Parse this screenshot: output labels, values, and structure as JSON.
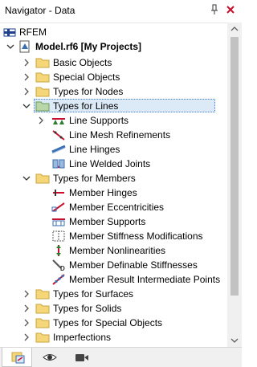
{
  "window": {
    "title": "Navigator - Data"
  },
  "tree": {
    "root": "RFEM",
    "model": "Model.rf6 [My Projects]",
    "items": [
      {
        "label": "Basic Objects"
      },
      {
        "label": "Special Objects"
      },
      {
        "label": "Types for Nodes"
      },
      {
        "label": "Types for Lines"
      },
      {
        "label": "Line Supports"
      },
      {
        "label": "Line Mesh Refinements"
      },
      {
        "label": "Line Hinges"
      },
      {
        "label": "Line Welded Joints"
      },
      {
        "label": "Types for Members"
      },
      {
        "label": "Member Hinges"
      },
      {
        "label": "Member Eccentricities"
      },
      {
        "label": "Member Supports"
      },
      {
        "label": "Member Stiffness Modifications"
      },
      {
        "label": "Member Nonlinearities"
      },
      {
        "label": "Member Definable Stiffnesses"
      },
      {
        "label": "Member Result Intermediate Points"
      },
      {
        "label": "Types for Surfaces"
      },
      {
        "label": "Types for Solids"
      },
      {
        "label": "Types for Special Objects"
      },
      {
        "label": "Imperfections"
      }
    ]
  },
  "colors": {
    "selection": "#dce9f7",
    "folder": "#f5d77a",
    "accent_red": "#c8102e"
  },
  "bottom_tabs": [
    "data-tab-icon",
    "view-tab-icon",
    "camera-tab-icon"
  ]
}
